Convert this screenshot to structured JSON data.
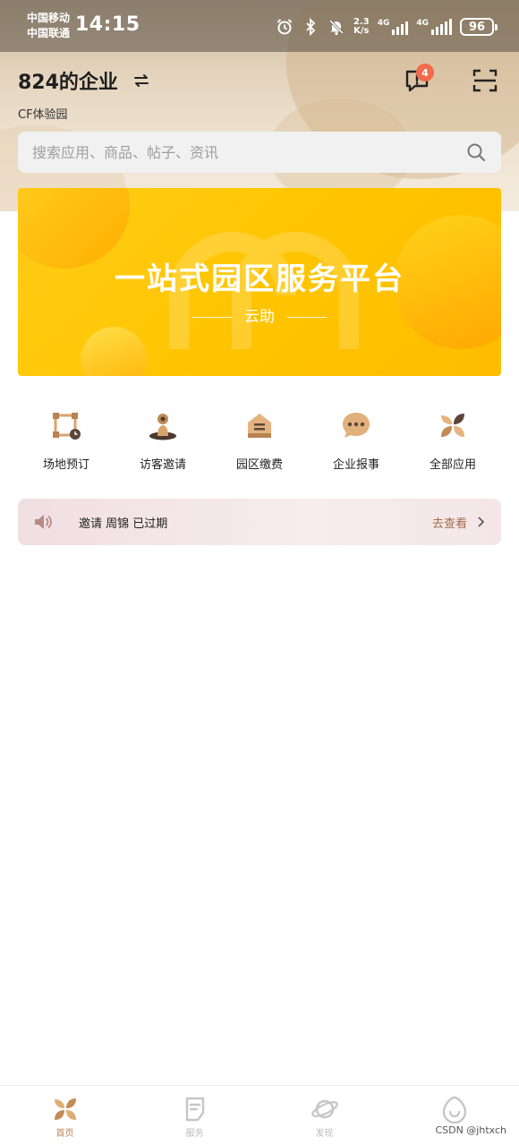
{
  "status_bar": {
    "carrier1": "中国移动",
    "carrier2": "中国联通",
    "time": "14:15",
    "net_speed_value": "2.3",
    "net_speed_unit": "K/s",
    "signal1_label": "4G",
    "signal2_label": "4G",
    "battery": "96"
  },
  "header": {
    "company_name": "824的企业",
    "park_name": "CF体验园",
    "message_badge": "4"
  },
  "search": {
    "placeholder": "搜索应用、商品、帖子、资讯"
  },
  "banner": {
    "title": "一站式园区服务平台",
    "subtitle": "云助"
  },
  "quick_menu": [
    {
      "label": "场地预订",
      "icon": "venue-booking-icon"
    },
    {
      "label": "访客邀请",
      "icon": "visitor-invite-icon"
    },
    {
      "label": "园区缴费",
      "icon": "park-payment-icon"
    },
    {
      "label": "企业报事",
      "icon": "enterprise-report-icon"
    },
    {
      "label": "全部应用",
      "icon": "all-apps-icon"
    }
  ],
  "notice": {
    "text": "邀请 周锦 已过期",
    "action": "去查看"
  },
  "tabbar": [
    {
      "label": "首页",
      "icon": "home-icon",
      "active": true
    },
    {
      "label": "服务",
      "icon": "service-icon",
      "active": false
    },
    {
      "label": "发现",
      "icon": "discover-icon",
      "active": false
    },
    {
      "label": "",
      "icon": "profile-icon",
      "active": false
    }
  ],
  "watermark": "CSDN @jhtxch",
  "colors": {
    "accent": "#b9835a",
    "banner_yellow": "#ffc400",
    "badge_red": "#f26a4b"
  }
}
